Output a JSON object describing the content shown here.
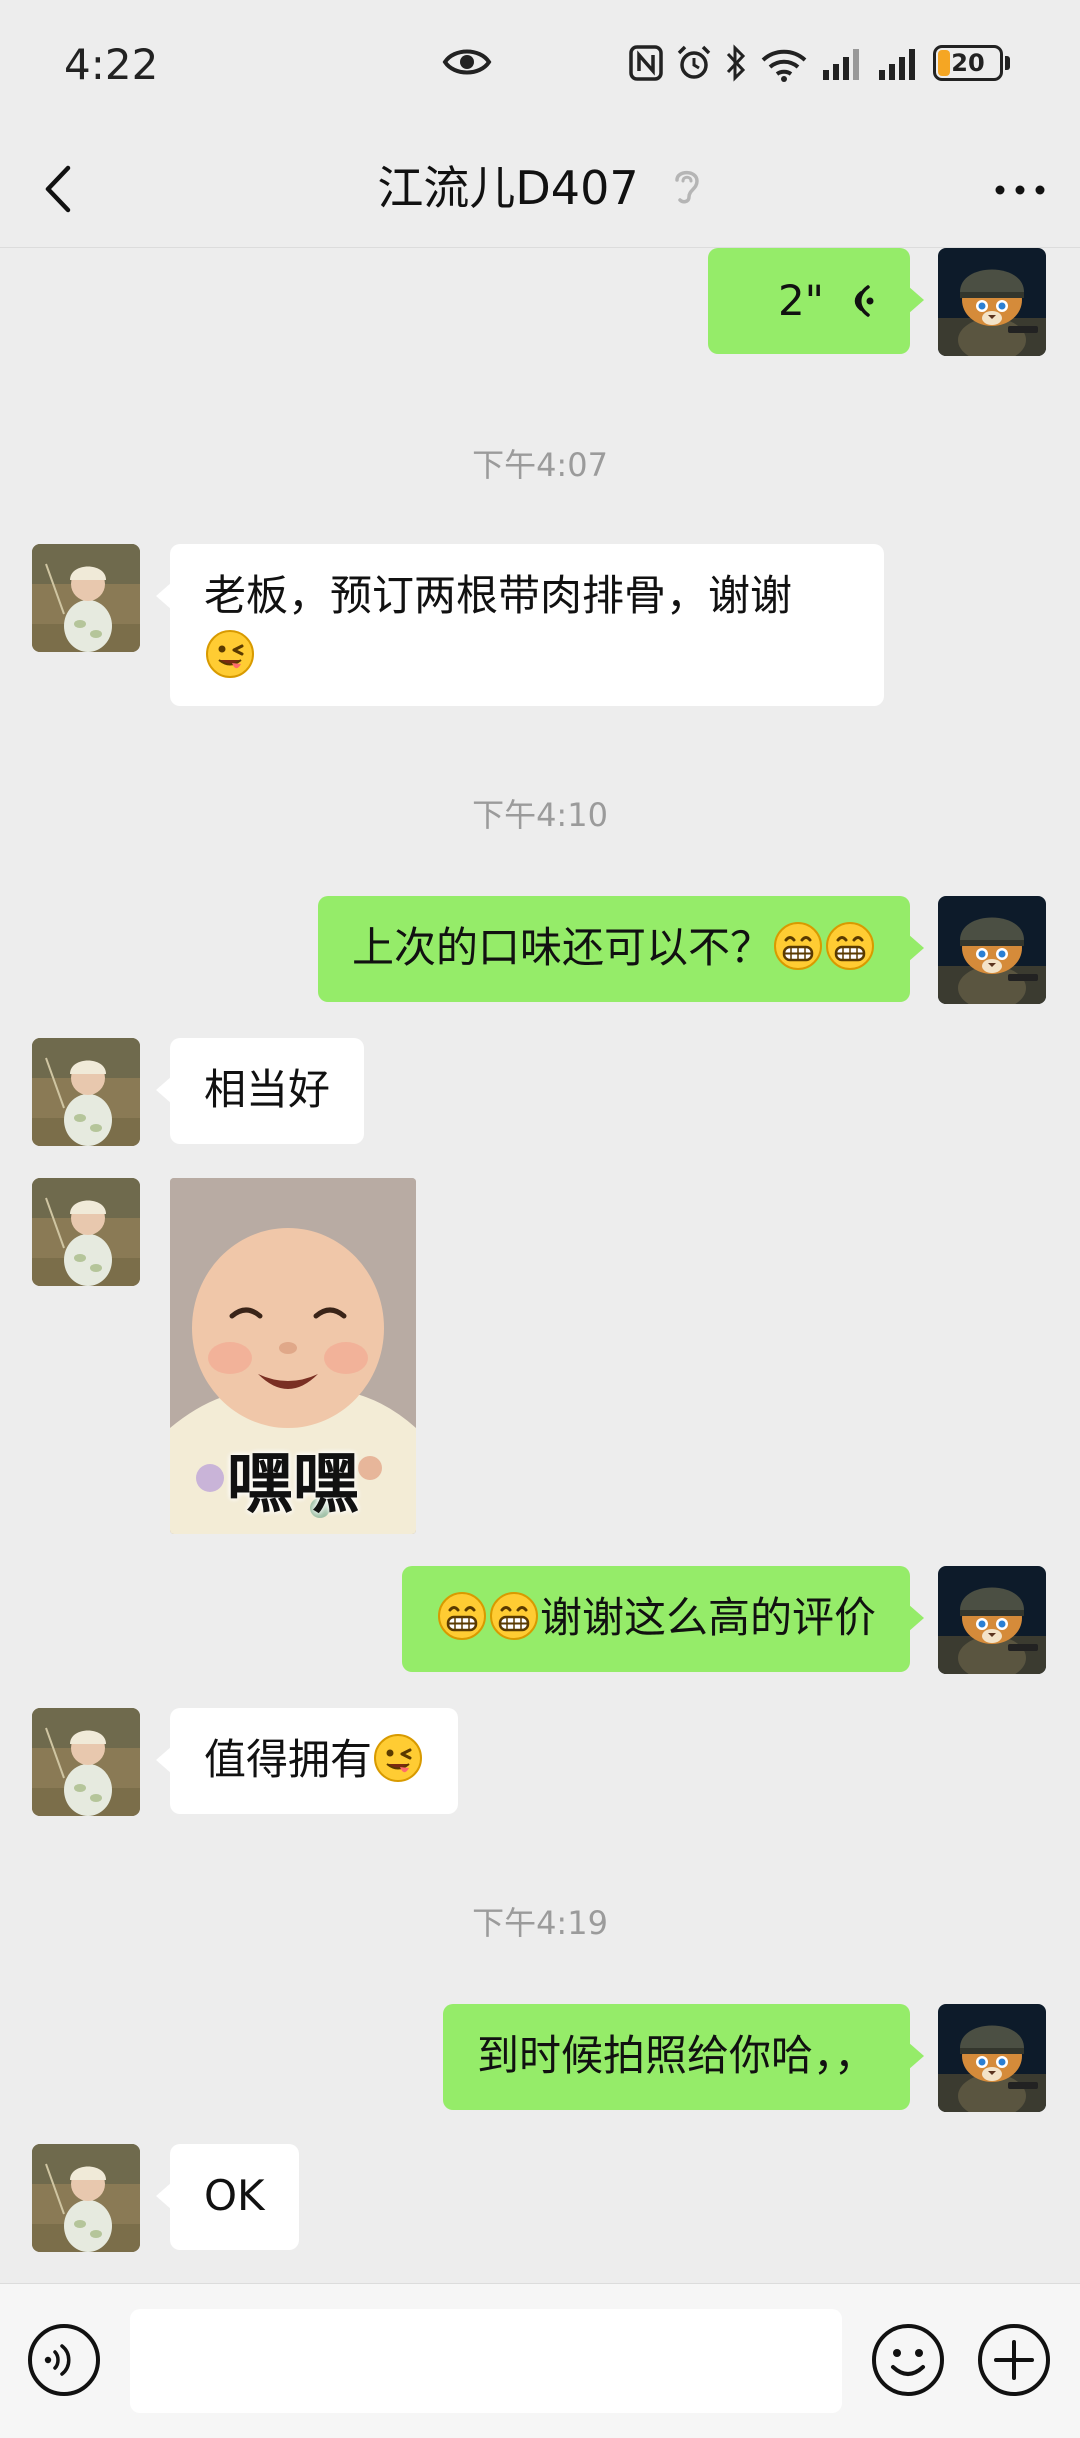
{
  "status_bar": {
    "time": "4:22",
    "battery": "20"
  },
  "header": {
    "title": "江流儿D407"
  },
  "messages": {
    "m1_voice_duration": "2\"",
    "ts1": "下午4:07",
    "m2_text": "老板，预订两根带肉排骨，谢谢",
    "ts2": "下午4:10",
    "m3_text": "上次的口味还可以不？",
    "m4_text": "相当好",
    "m5_sticker_text": "嘿嘿",
    "m6_text": "谢谢这么高的评价",
    "m7_text": "值得拥有",
    "ts3": "下午4:19",
    "m8_text": "到时候拍照给你哈，，",
    "m9_text": "OK"
  },
  "input": {
    "placeholder": ""
  },
  "colors": {
    "background": "#ededed",
    "outgoing_bubble": "#95ec69",
    "incoming_bubble": "#ffffff",
    "timestamp": "#9b9b9b"
  },
  "icons": {
    "back": "chevron-left-icon",
    "ear": "ear-icon",
    "more": "more-dots-icon",
    "voice": "voice-message-icon",
    "emoji": "smiley-icon",
    "plus": "plus-icon"
  }
}
